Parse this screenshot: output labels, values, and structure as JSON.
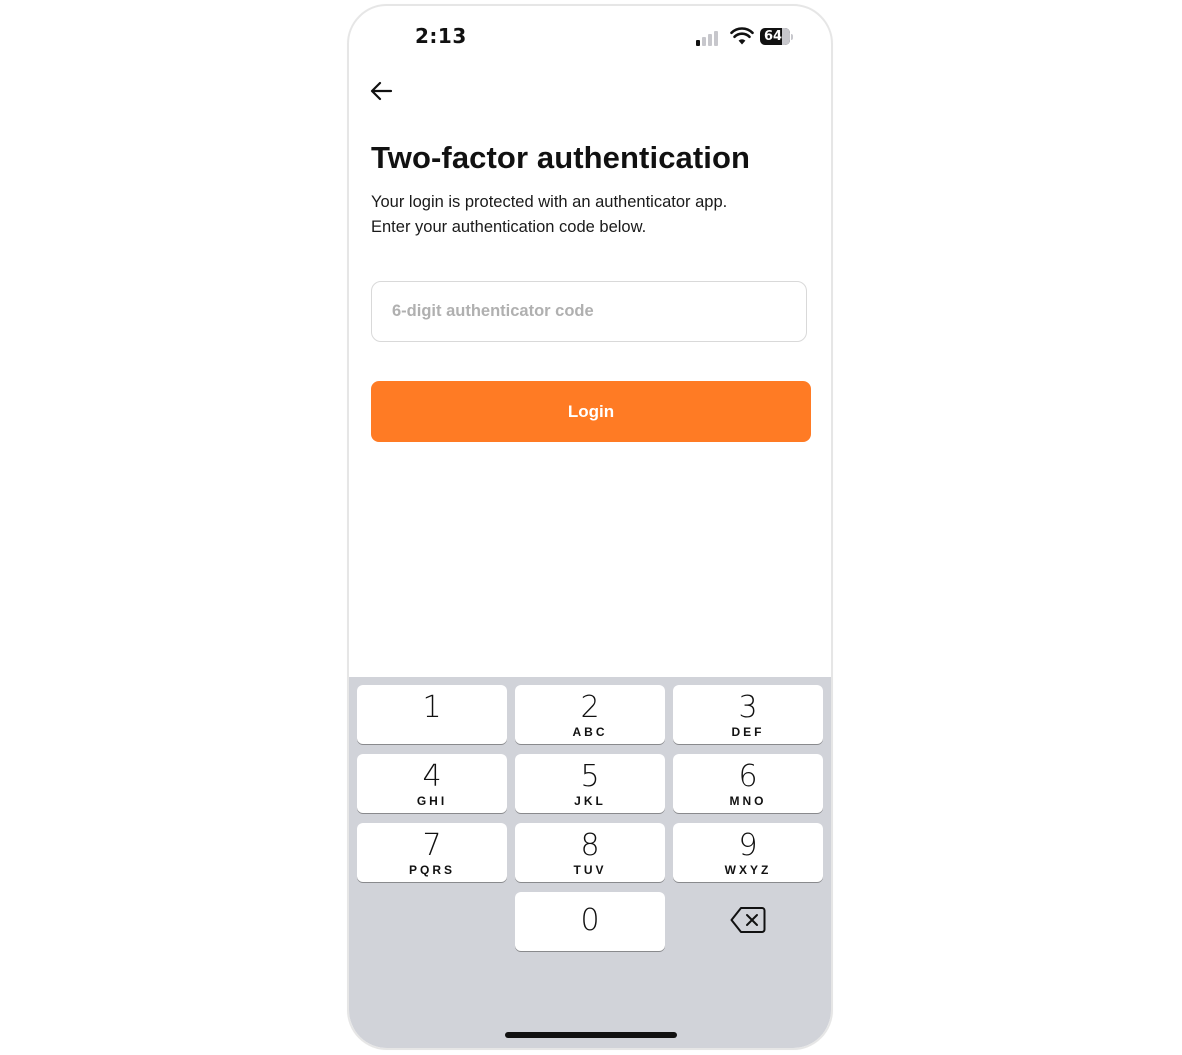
{
  "status_bar": {
    "time": "2:13",
    "battery_level": "64",
    "icons": [
      "signal-icon",
      "wifi-icon",
      "battery-icon"
    ]
  },
  "header": {
    "back_icon": "arrow-left-icon"
  },
  "content": {
    "title": "Two-factor authentication",
    "subtitle_line1": "Your login is protected with an authenticator app.",
    "subtitle_line2": "Enter your authentication code below.",
    "code_input": {
      "placeholder": "6-digit authenticator code",
      "value": ""
    },
    "login_button": "Login"
  },
  "keypad": {
    "keys": [
      {
        "digit": "1",
        "letters": ""
      },
      {
        "digit": "2",
        "letters": "ABC"
      },
      {
        "digit": "3",
        "letters": "DEF"
      },
      {
        "digit": "4",
        "letters": "GHI"
      },
      {
        "digit": "5",
        "letters": "JKL"
      },
      {
        "digit": "6",
        "letters": "MNO"
      },
      {
        "digit": "7",
        "letters": "PQRS"
      },
      {
        "digit": "8",
        "letters": "TUV"
      },
      {
        "digit": "9",
        "letters": "WXYZ"
      },
      {
        "digit": "0",
        "letters": ""
      }
    ],
    "delete_icon": "backspace-icon"
  },
  "colors": {
    "accent": "#ff7b24",
    "keyboard_bg": "#d1d3d9",
    "input_border": "#d9d9d9"
  }
}
